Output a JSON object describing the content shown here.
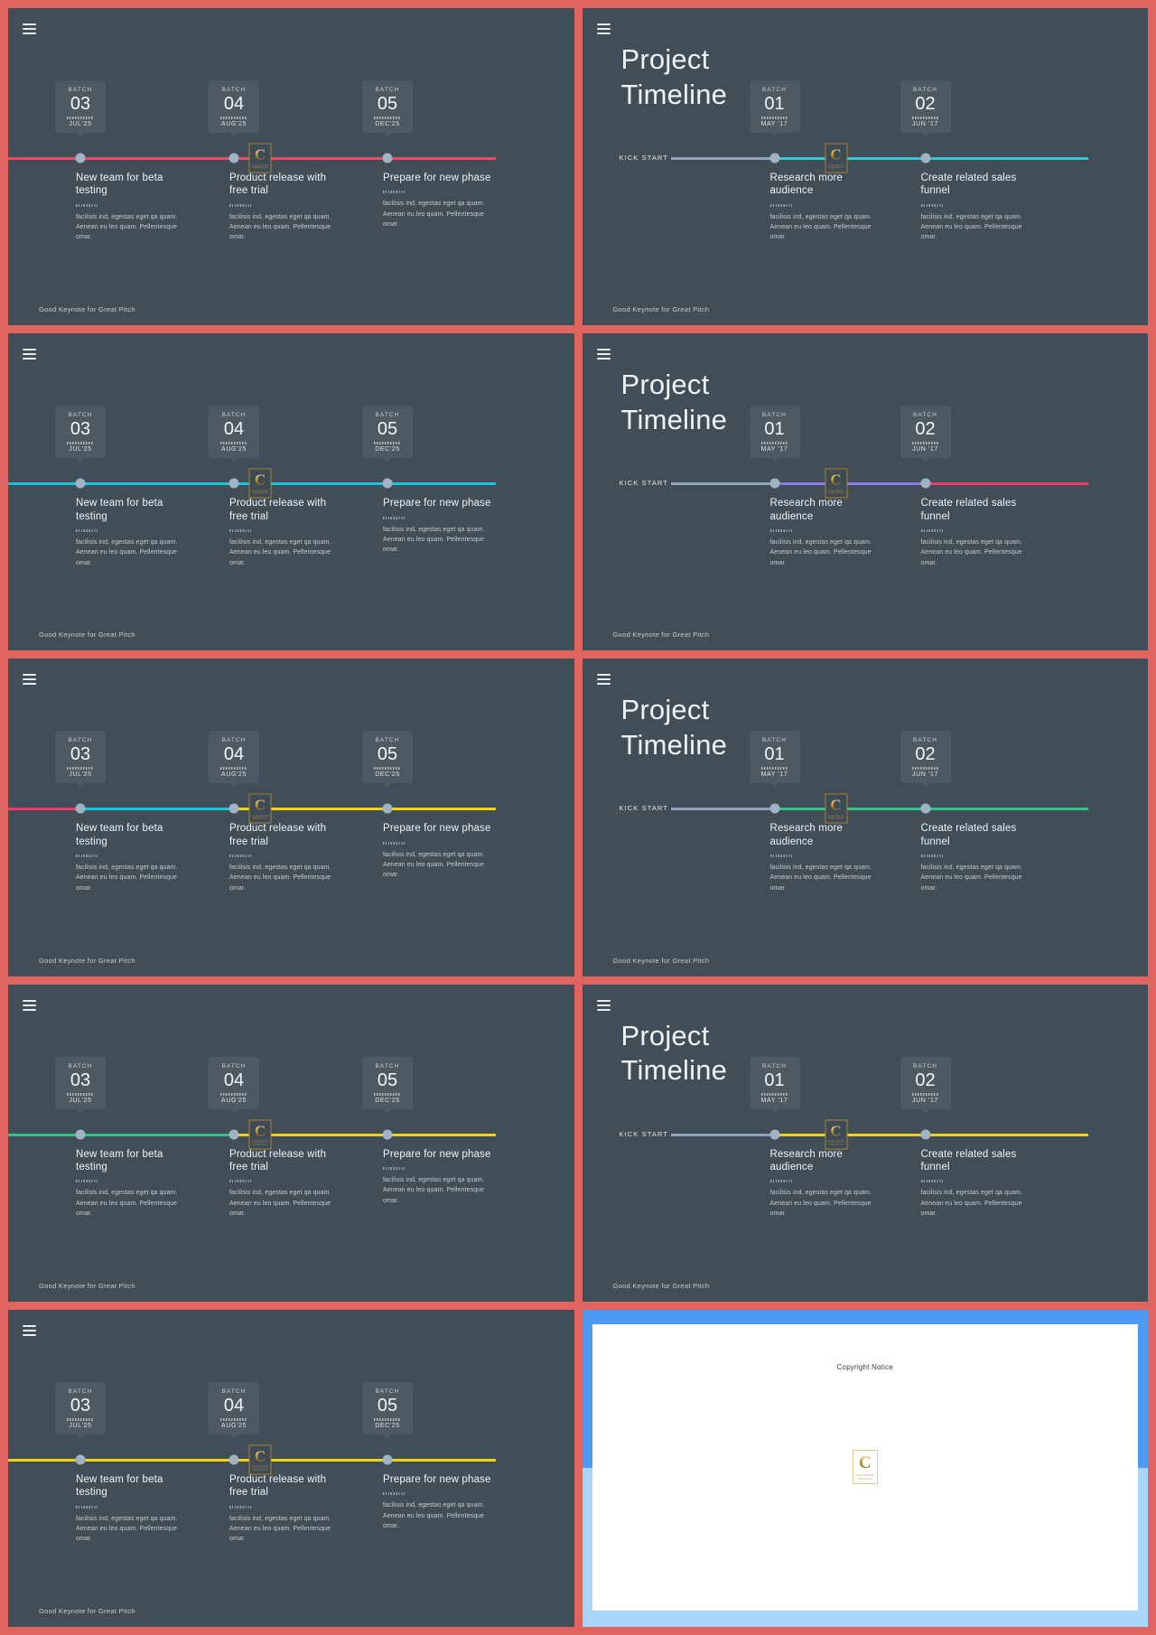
{
  "deck": {
    "footer_text": "Good Keynote for Great Pitch",
    "menu_icon": "hamburger-menu-icon",
    "logo_letter": "C",
    "logo_line1": "CONCRETE",
    "logo_line2": "TEMPLATES",
    "accent_frame_color": "#e0645f",
    "slide_bg_color": "#414e58",
    "card_bg_color": "#4d5a64",
    "dot_color": "#9fb3c4"
  },
  "title_slides": {
    "title": "Project\nTimeline",
    "kick_start_label": "KICK  START"
  },
  "batch_label": "BATCH",
  "left_slide": {
    "cards": [
      {
        "label": "BATCH",
        "number": "03",
        "month": "JUL'25"
      },
      {
        "label": "BATCH",
        "number": "04",
        "month": "AUG'25"
      },
      {
        "label": "BATCH",
        "number": "05",
        "month": "DEC'25"
      }
    ],
    "events": [
      {
        "title": "New team for beta testing",
        "body": "facilisis ind, egestas eget qa quam. Aenean eu leo quam. Pellentesque omar."
      },
      {
        "title": "Product release with free trial",
        "body": "facilisis ind, egestas eget qa quam. Aenean eu leo quam. Pellentesque omar."
      },
      {
        "title": "Prepare for new phase",
        "body": "facilisis ind, egestas eget qa quam. Aenean eu leo quam. Pellentesque omar."
      }
    ]
  },
  "right_slide": {
    "cards": [
      {
        "label": "BATCH",
        "number": "01",
        "month": "MAY '17"
      },
      {
        "label": "BATCH",
        "number": "02",
        "month": "JUN '17"
      }
    ],
    "events": [
      {
        "title": "Research more audience",
        "body": "facilisis ind, egestas eget qa quam. Aenean eu leo quam. Pellentesque omar."
      },
      {
        "title": "Create related sales funnel",
        "body": "facilisis ind, egestas eget qa quam. Aenean eu leo quam. Pellentesque omar."
      }
    ]
  },
  "rows": [
    {
      "left_colors": [
        "#ec4a63",
        "#ec4a63",
        "#ec4a63"
      ],
      "right_colors": [
        "#8fa4bb",
        "#2ec8d8",
        "#2ec8d8"
      ]
    },
    {
      "left_colors": [
        "#16c6d9",
        "#16c6d9",
        "#16c6d9"
      ],
      "right_colors": [
        "#8fa4bb",
        "#8b7ae8",
        "#ef3d72"
      ]
    },
    {
      "left_colors": [
        "#ec3c6e",
        "#16c6d9",
        "#f2d318"
      ],
      "right_colors": [
        "#8fa4bb",
        "#2fc48a",
        "#2fc48a"
      ]
    },
    {
      "left_colors": [
        "#2fc48a",
        "#2fc48a",
        "#f2d318"
      ],
      "right_colors": [
        "#8fa4bb",
        "#f2d318",
        "#f2d318"
      ]
    },
    {
      "left_colors": [
        "#f2d318",
        "#f2d318",
        "#f2d318"
      ],
      "right_colors": null
    }
  ],
  "copyright_slide": {
    "title": "Copyright Notice",
    "logo_letter": "C",
    "logo_line1": "CONCRETE",
    "logo_line2": "TEMPLATES",
    "top_band_color": "#4a9bf5",
    "bottom_band_color": "#a9d5fb"
  }
}
